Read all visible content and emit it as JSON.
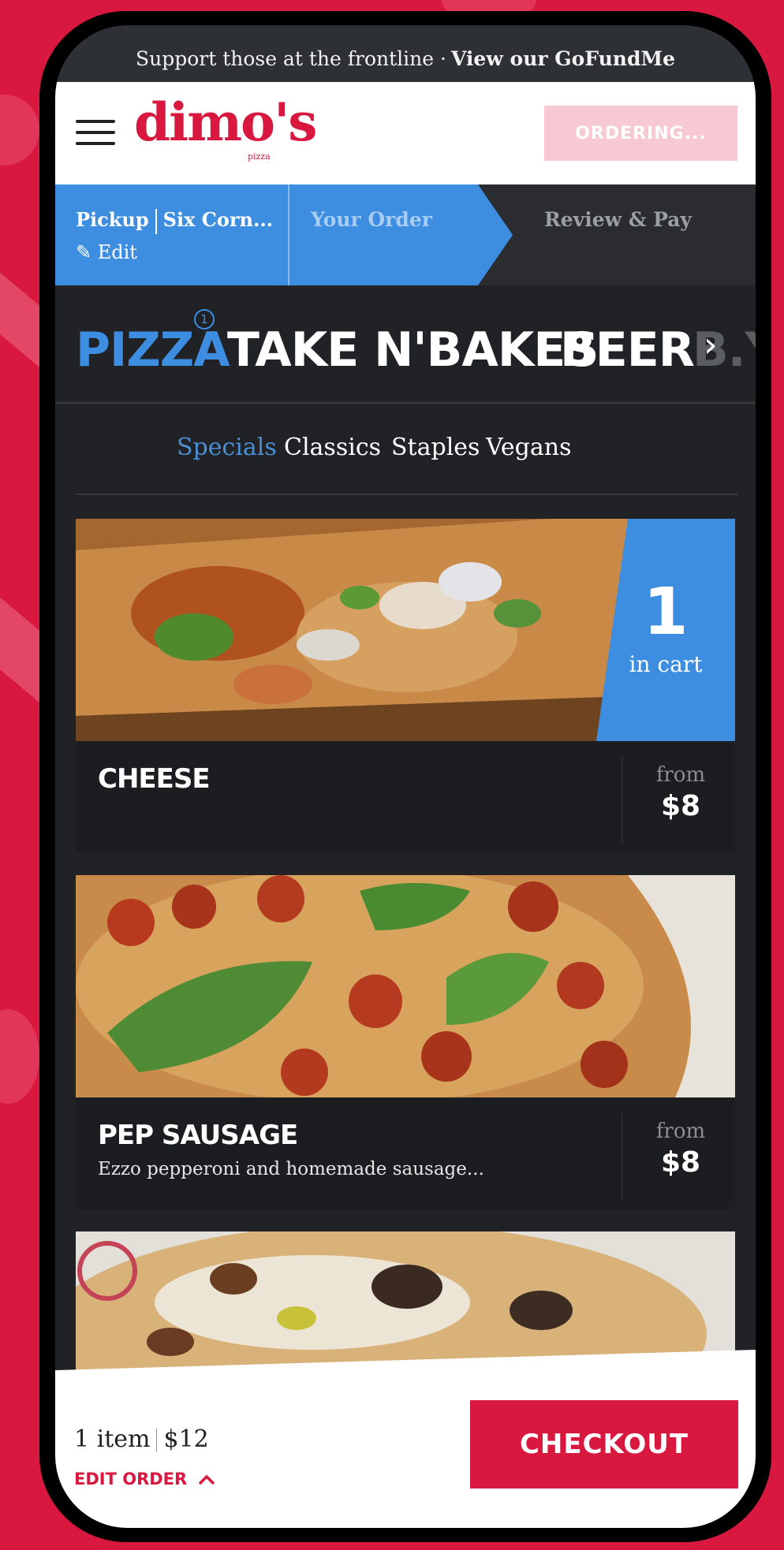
{
  "banner": {
    "text": "Support those at the frontline ·",
    "link": "View our GoFundMe"
  },
  "header": {
    "logo": "dimo's",
    "logo_sub": "pizza",
    "ordering_button": "ORDERING..."
  },
  "steps": {
    "pickup": "Pickup",
    "location": "Six Corn...",
    "edit": "Edit",
    "your_order": "Your Order",
    "review_pay": "Review & Pay"
  },
  "categories": {
    "items": [
      "PIZZA",
      "TAKE N'BAKES",
      "BEER",
      "B.Y"
    ],
    "pizza_badge": "1",
    "next_arrow": "›"
  },
  "subtabs": [
    "Specials",
    "Classics",
    "Staples",
    "Vegans"
  ],
  "menu": [
    {
      "name": "CHEESE",
      "description": "",
      "from": "from",
      "price": "$8",
      "in_cart_count": "1",
      "in_cart_label": "in cart"
    },
    {
      "name": "PEP SAUSAGE",
      "description": "Ezzo pepperoni and homemade sausage...",
      "from": "from",
      "price": "$8"
    }
  ],
  "footer": {
    "items": "1 item",
    "total": "$12",
    "edit_order": "EDIT ORDER",
    "edit_order_icon": "chevron-up-icon",
    "checkout": "CHECKOUT"
  },
  "colors": {
    "brand_red": "#d8183f",
    "accent_blue": "#3d8de0",
    "dark_bg": "#202226"
  }
}
